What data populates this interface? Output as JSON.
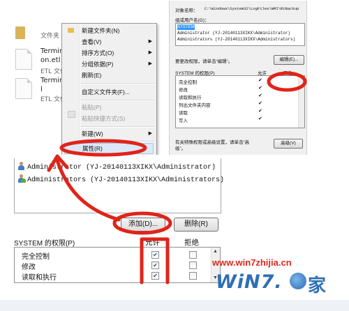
{
  "explorer": {
    "folder_label": "文件夹",
    "files": [
      {
        "name_line1": "Terminal",
        "name_line2": "on.etl",
        "type": "ETL 文件"
      },
      {
        "name_line1": "Terminal",
        "name_line2": "l",
        "type": "ETL 文件"
      }
    ]
  },
  "context_menu": {
    "items": [
      {
        "label": "新建文件夹(N)",
        "has_submenu": false,
        "disabled": false
      },
      {
        "label": "查看(V)",
        "has_submenu": true,
        "disabled": false
      },
      {
        "label": "排序方式(O)",
        "has_submenu": true,
        "disabled": false
      },
      {
        "label": "分组依据(P)",
        "has_submenu": true,
        "disabled": false
      },
      {
        "label": "刷新(E)",
        "has_submenu": false,
        "disabled": false
      },
      {
        "label": "自定义文件夹(F)...",
        "has_submenu": false,
        "disabled": false
      },
      {
        "label": "粘贴(P)",
        "has_submenu": false,
        "disabled": true
      },
      {
        "label": "粘贴快捷方式(S)",
        "has_submenu": false,
        "disabled": true
      },
      {
        "label": "新建(W)",
        "has_submenu": true,
        "disabled": false
      },
      {
        "label": "属性(R)",
        "has_submenu": false,
        "disabled": false,
        "highlighted": true
      }
    ]
  },
  "security_panel": {
    "object_name_label": "对象名称：",
    "object_name_value": "C:\\Windows\\System32\\LogFiles\\WMI\\RtBackup",
    "group_label": "组或用户名(G)：",
    "users": [
      "SYSTEM",
      "Administrator (YJ-20140113XIKX\\Administrator)",
      "Administrators (YJ-20140113XIKX\\Administrators)"
    ],
    "change_hint": "要更改权限，请单击“编辑”。",
    "edit_button": "编辑(E)...",
    "perm_label": "SYSTEM 的权限(P)",
    "allow_label": "允许",
    "deny_label": "拒绝",
    "permissions": [
      "完全控制",
      "修改",
      "读取和执行",
      "列出文件夹内容",
      "读取",
      "写入"
    ],
    "advanced_hint_line1": "有关特殊权限或高级设置，请单击“高",
    "advanced_hint_line2": "级”。",
    "advanced_button": "高级(V)"
  },
  "bottom": {
    "users": [
      {
        "name": "Administrator (YJ-20140113XIKX\\Administrator)"
      },
      {
        "name": "Administrators (YJ-20140113XIKX\\Administrators)"
      }
    ],
    "add_button": "添加(D)...",
    "remove_button": "删除(R)",
    "perm_label": "SYSTEM 的权限(P)",
    "allow_label": "允许",
    "deny_label": "拒绝",
    "permissions": [
      {
        "name": "完全控制",
        "allow": true,
        "deny": false
      },
      {
        "name": "修改",
        "allow": true,
        "deny": false
      },
      {
        "name": "读取和执行",
        "allow": true,
        "deny": false
      }
    ]
  },
  "watermark": {
    "url": "www.win7zhijia.cn",
    "logo_text": "WiN7.",
    "logo_cn": "家"
  },
  "colors": {
    "annotation_red": "#e0241a",
    "menu_background": "#f0f0f0",
    "selection_blue": "#3399ff",
    "watermark_red": "#e1251b",
    "logo_blue": "#2f6fb4"
  }
}
